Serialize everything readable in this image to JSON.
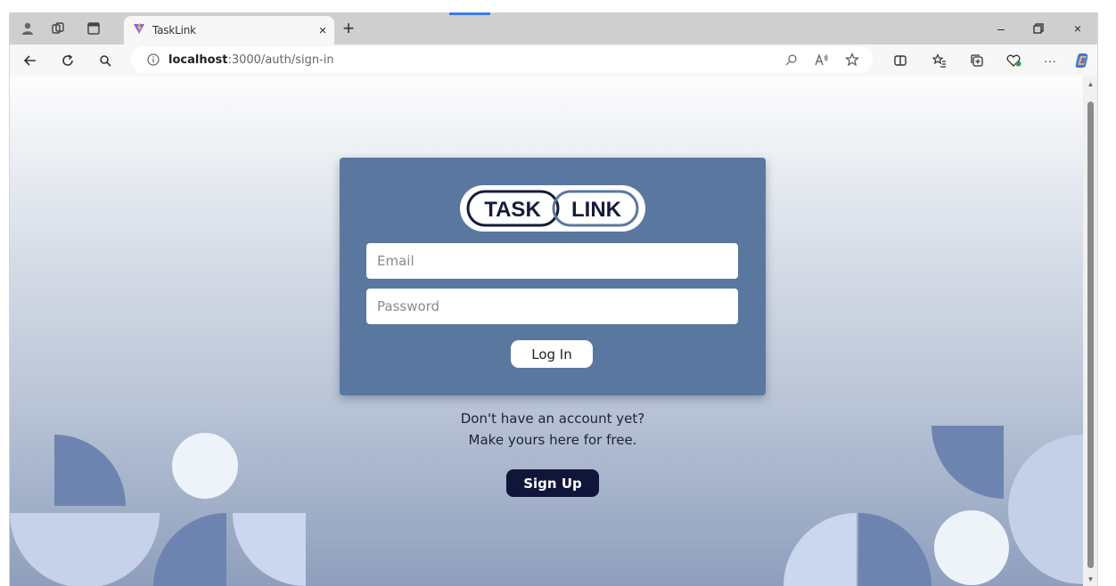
{
  "browser": {
    "tab": {
      "title": "TaskLink"
    },
    "address_bar": {
      "host": "localhost",
      "path": ":3000/auth/sign-in"
    },
    "icons": {
      "profile": "profile-icon",
      "workspaces": "workspaces-icon",
      "tab_actions": "tab-actions-icon",
      "favicon": "vite-favicon-icon",
      "close_tab": "close-icon",
      "new_tab": "plus-icon",
      "minimize": "minimize-icon",
      "restore": "restore-icon",
      "close_window": "close-icon",
      "back": "back-arrow-icon",
      "refresh": "refresh-icon",
      "search": "search-icon",
      "site_info": "info-icon",
      "zoom": "zoom-icon",
      "read_aloud": "read-aloud-icon",
      "favorite": "star-icon",
      "split_screen": "split-screen-icon",
      "favorites": "favorites-icon",
      "collections": "collections-icon",
      "performance": "heart-icon",
      "more": "ellipsis-icon",
      "copilot": "copilot-icon"
    },
    "close_glyph": "×",
    "new_tab_glyph": "+",
    "minimize_glyph": "–",
    "restore_glyph": "⧉",
    "more_glyph": "···"
  },
  "login": {
    "logo": {
      "left": "TASK",
      "right": "LINK"
    },
    "email_placeholder": "Email",
    "password_placeholder": "Password",
    "login_label": "Log In",
    "signup_line1": "Don't have an account yet?",
    "signup_line2": "Make yours here for free.",
    "signup_label": "Sign Up"
  },
  "colors": {
    "card": "#5a77a0",
    "signup_button": "#10163a",
    "shape_dark": "#6e84b0",
    "shape_light": "#c7d2ea",
    "shape_white": "#eef3fa"
  }
}
